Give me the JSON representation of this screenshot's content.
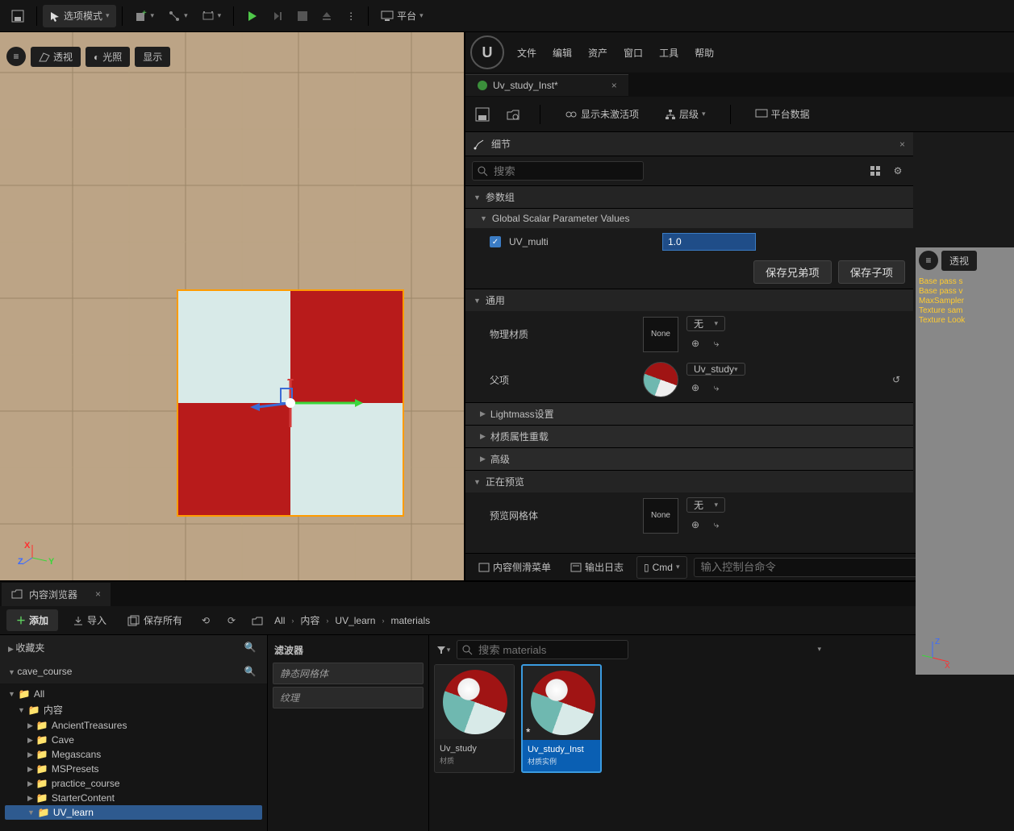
{
  "top_toolbar": {
    "selection_mode": "选项模式",
    "platform": "平台"
  },
  "viewport": {
    "perspective": "透视",
    "lighting": "光照",
    "show": "显示",
    "axes": {
      "x": "X",
      "y": "Y",
      "z": "Z"
    }
  },
  "material_editor": {
    "menus": {
      "file": "文件",
      "edit": "编辑",
      "asset": "资产",
      "window": "窗口",
      "tools": "工具",
      "help": "帮助"
    },
    "tab": "Uv_study_Inst*",
    "toolbar": {
      "show_inactive": "显示未激活项",
      "hierarchy": "层级",
      "platform_data": "平台数据"
    },
    "details_tab": "细节",
    "search_placeholder": "搜索",
    "sections": {
      "param_group": "参数组",
      "global_scalar": "Global Scalar Parameter Values",
      "uv_multi_label": "UV_multi",
      "uv_multi_value": "1.0",
      "save_sibling": "保存兄弟项",
      "save_child": "保存子项",
      "general": "通用",
      "phys_mat": "物理材质",
      "none": "None",
      "none_cn": "无",
      "parent": "父项",
      "parent_value": "Uv_study",
      "lightmass": "Lightmass设置",
      "mat_override": "材质属性重载",
      "advanced": "高级",
      "previewing": "正在预览",
      "preview_mesh": "预览网格体"
    },
    "right_overlay": {
      "perspective_pill": "透视",
      "lines": [
        "Base pass s",
        "Base pass v",
        "MaxSampler",
        "Texture sam",
        "Texture Look"
      ]
    },
    "footer": {
      "content_menu": "内容侧滑菜单",
      "output_log": "输出日志",
      "cmd_label": "Cmd",
      "console_placeholder": "输入控制台命令"
    }
  },
  "content_browser": {
    "tab": "内容浏览器",
    "add": "添加",
    "import": "导入",
    "save_all": "保存所有",
    "breadcrumb": [
      "All",
      "内容",
      "UV_learn",
      "materials"
    ],
    "favorites": "收藏夹",
    "project": "cave_course",
    "tree": {
      "all": "All",
      "content": "内容",
      "items": [
        "AncientTreasures",
        "Cave",
        "Megascans",
        "MSPresets",
        "practice_course",
        "StarterContent",
        "UV_learn"
      ]
    },
    "filters_label": "滤波器",
    "filter_chips": [
      "静态网格体",
      "纹理"
    ],
    "asset_search_placeholder": "搜索 materials",
    "assets": [
      {
        "name": "Uv_study",
        "type": "材质"
      },
      {
        "name": "Uv_study_Inst",
        "type": "材质实例"
      }
    ]
  }
}
